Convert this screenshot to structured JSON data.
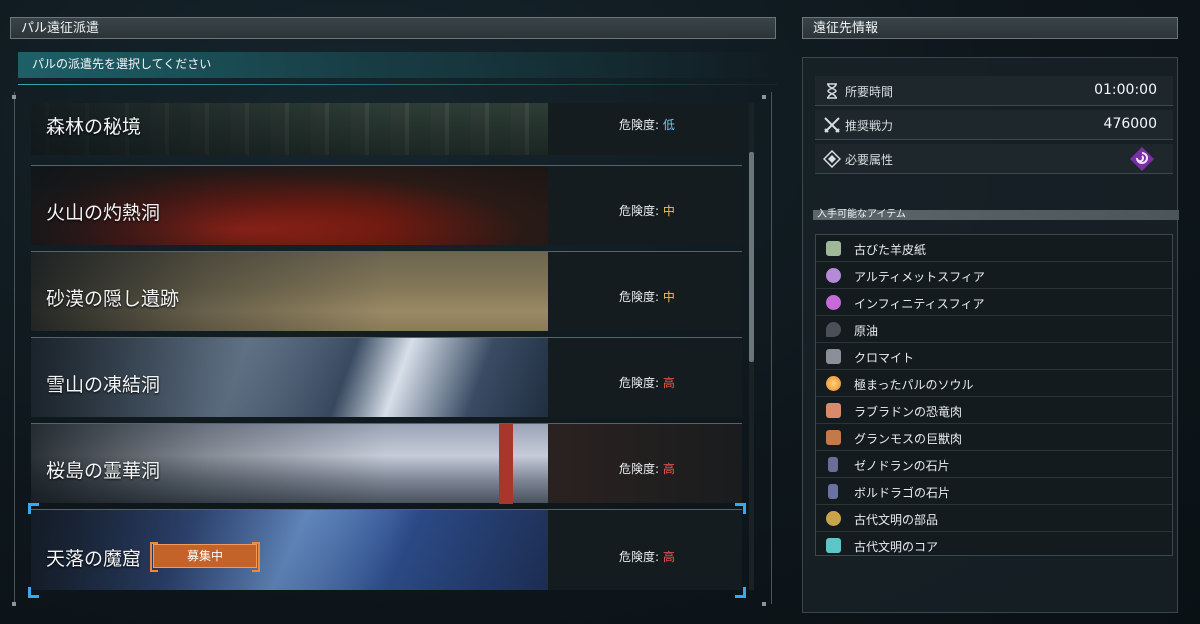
{
  "left_panel": {
    "title": "パル遠征派遣",
    "subtitle": "パルの派遣先を選択してください",
    "destinations": [
      {
        "name": "森林の秘境",
        "risk_label": "危険度:",
        "risk_value": "低",
        "risk_color": "#6ec9ef"
      },
      {
        "name": "火山の灼熱洞",
        "risk_label": "危険度:",
        "risk_value": "中",
        "risk_color": "#f2c14c"
      },
      {
        "name": "砂漠の隠し遺跡",
        "risk_label": "危険度:",
        "risk_value": "中",
        "risk_color": "#f2c14c"
      },
      {
        "name": "雪山の凍結洞",
        "risk_label": "危険度:",
        "risk_value": "高",
        "risk_color": "#ef5a4d"
      },
      {
        "name": "桜島の霊華洞",
        "risk_label": "危険度:",
        "risk_value": "高",
        "risk_color": "#ef5a4d"
      },
      {
        "name": "天落の魔窟",
        "risk_label": "危険度:",
        "risk_value": "高",
        "risk_color": "#ef5a4d",
        "badge": "募集中"
      }
    ],
    "selected_index": 5,
    "accent_color": "#37a9ec"
  },
  "right_panel": {
    "title": "遠征先情報",
    "stats": [
      {
        "label": "所要時間",
        "value": "01:00:00",
        "icon": "hourglass-icon"
      },
      {
        "label": "推奨戦力",
        "value": "476000",
        "icon": "crossed-swords-icon"
      },
      {
        "label": "必要属性",
        "value": "",
        "icon": "diamond-icon",
        "element_icon": "dark-element-icon"
      }
    ],
    "items_header": "入手可能なアイテム",
    "items": [
      {
        "name": "古びた羊皮紙",
        "icon": "parchment-icon",
        "color": "#9fb89a"
      },
      {
        "name": "アルティメットスフィア",
        "icon": "ultimate-sphere-icon",
        "color": "#b58ad6"
      },
      {
        "name": "インフィニティスフィア",
        "icon": "infinity-sphere-icon",
        "color": "#c56ad8"
      },
      {
        "name": "原油",
        "icon": "crude-oil-icon",
        "color": "#4a4f58"
      },
      {
        "name": "クロマイト",
        "icon": "chromite-icon",
        "color": "#8a8f99"
      },
      {
        "name": "極まったパルのソウル",
        "icon": "pal-soul-icon",
        "color": "#e8882a"
      },
      {
        "name": "ラブラドンの恐竜肉",
        "icon": "dinosaur-meat-icon",
        "color": "#d98a6a"
      },
      {
        "name": "グランモスの巨獣肉",
        "icon": "mammoth-meat-icon",
        "color": "#c27a4a"
      },
      {
        "name": "ゼノドランの石片",
        "icon": "xenodran-shard-icon",
        "color": "#6a6f9a"
      },
      {
        "name": "ボルドラゴの石片",
        "icon": "boldrago-shard-icon",
        "color": "#6a72a0"
      },
      {
        "name": "古代文明の部品",
        "icon": "ancient-part-icon",
        "color": "#c9a44a"
      },
      {
        "name": "古代文明のコア",
        "icon": "ancient-core-icon",
        "color": "#5ec6c9"
      }
    ]
  }
}
